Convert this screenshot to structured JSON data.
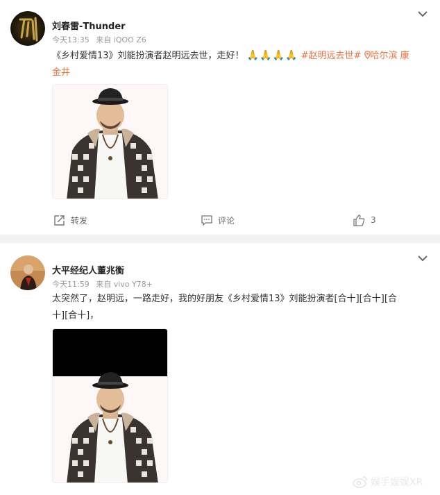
{
  "posts": [
    {
      "author": "刘春雷-Thunder",
      "time": "今天13:35",
      "source": "来自 iQOO Z6",
      "text_main": "《乡村爱情13》刘能扮演者赵明远去世，走好！",
      "emoji": "🙏🙏🙏🙏",
      "topic": "#赵明远去世#",
      "location_icon": "location-pin-icon",
      "location_part1": "哈尔滨 康",
      "location_part2": "金井",
      "actions": {
        "repost_label": "转发",
        "comment_label": "评论",
        "like_count": "3"
      }
    },
    {
      "author": "大平经纪人董兆衡",
      "time": "今天11:59",
      "source": "来自 vivo Y78+",
      "text_line1": "太突然了，赵明远，一路走好，我的好朋友《乡村爱情13》刘能扮演者[合十][合十][合",
      "text_line2": "十][合十]，"
    }
  ],
  "watermark": "娱手娱娱XR",
  "colors": {
    "accent": "#eb7340",
    "text": "#333333",
    "meta": "#999999",
    "divider": "#f2f2f2"
  }
}
